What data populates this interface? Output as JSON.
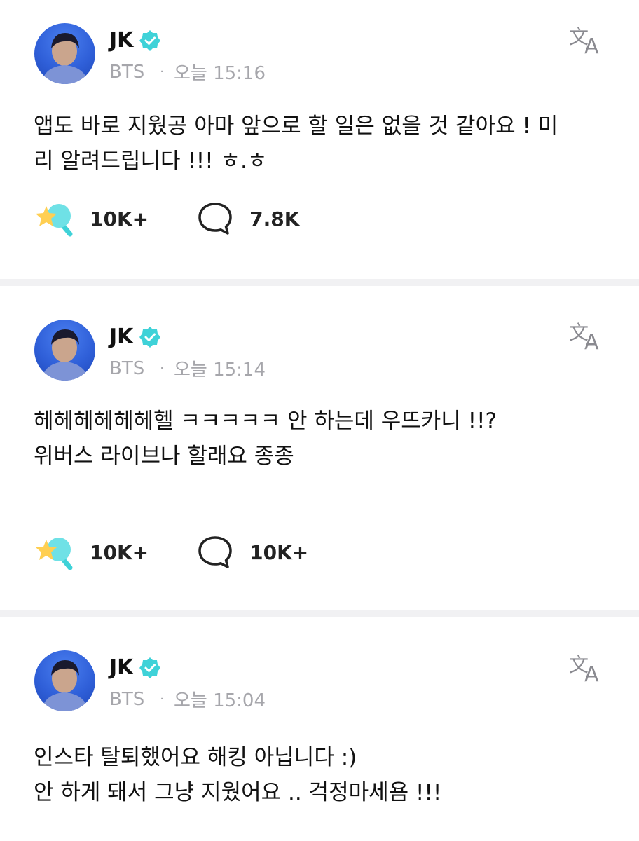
{
  "posts": [
    {
      "author": "JK",
      "group": "BTS",
      "separator": "·",
      "time": "오늘 15:16",
      "text": "앱도 바로 지웠공 아마 앞으로 할 일은 없을 것 같아요 ! 미\n리 알려드립니다 !!! ㅎ.ㅎ",
      "reactions": "10K+",
      "comments": "7.8K"
    },
    {
      "author": "JK",
      "group": "BTS",
      "separator": "·",
      "time": "오늘 15:14",
      "text": "헤헤헤헤헤헤헬 ㅋㅋㅋㅋㅋ 안 하는데 우뜨카니 !!?\n위버스 라이브나 할래요 종종",
      "reactions": "10K+",
      "comments": "10K+"
    },
    {
      "author": "JK",
      "group": "BTS",
      "separator": "·",
      "time": "오늘 15:04",
      "text": "인스타 탈퇴했어요 해킹 아닙니다 :)\n안 하게 돼서 그냥 지웠어요 .. 걱정마세욤 !!!"
    }
  ],
  "icons": {
    "verified": "verified-badge-icon",
    "translate": "translate-icon",
    "reaction": "star-reaction-icon",
    "comment": "comment-bubble-icon"
  },
  "colors": {
    "accent": "#3fd2d8",
    "meta_gray": "#a6a6ab",
    "star_yellow": "#ffcf52",
    "divider": "#f1f1f3"
  }
}
